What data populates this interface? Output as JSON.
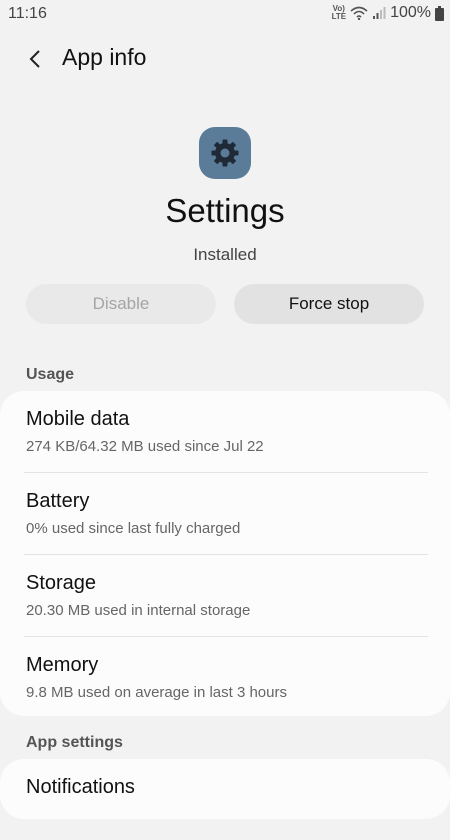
{
  "status_bar": {
    "time": "11:16",
    "volte_top": "Vo)",
    "volte_bottom": "LTE",
    "battery_percent": "100%",
    "icons": [
      "volte-icon",
      "wifi-icon",
      "signal-icon",
      "battery-icon"
    ]
  },
  "header": {
    "back_icon": "chevron-left-icon",
    "title": "App info"
  },
  "app": {
    "icon": "gear-icon",
    "icon_color": "#5b7c99",
    "name": "Settings",
    "status": "Installed"
  },
  "actions": {
    "disable_label": "Disable",
    "force_stop_label": "Force stop"
  },
  "usage": {
    "title": "Usage",
    "items": [
      {
        "title": "Mobile data",
        "subtitle": "274 KB/64.32 MB used since Jul 22"
      },
      {
        "title": "Battery",
        "subtitle": "0% used since last fully charged"
      },
      {
        "title": "Storage",
        "subtitle": "20.30 MB used in internal storage"
      },
      {
        "title": "Memory",
        "subtitle": "9.8 MB used on average in last 3 hours"
      }
    ]
  },
  "app_settings": {
    "title": "App settings",
    "items": [
      {
        "title": "Notifications"
      }
    ]
  }
}
